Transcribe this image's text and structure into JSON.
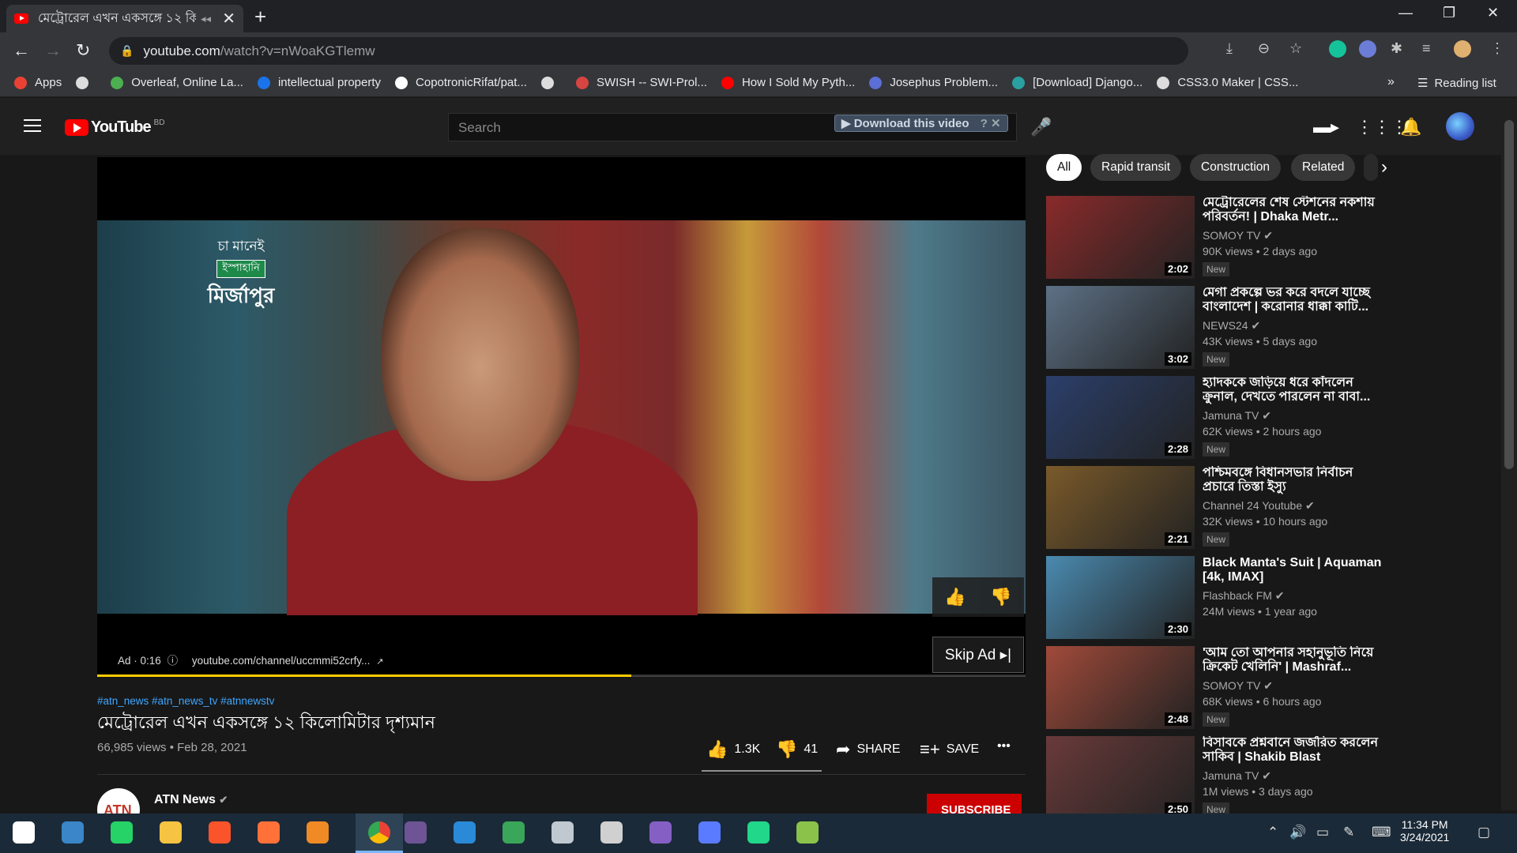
{
  "tab": {
    "title": "মেট্রোরেল এখন একসঙ্গে ১২ কি",
    "mute_symbol": "◂◂",
    "close": "✕",
    "new_tab": "+"
  },
  "window_controls": {
    "minimize": "—",
    "restore": "❐",
    "close": "✕"
  },
  "address": {
    "host": "youtube.com",
    "path": "/watch?v=nWoaKGTlemw"
  },
  "bookmarks": [
    {
      "label": "Apps",
      "color": "#e94235"
    },
    {
      "label": "",
      "color": "#dddddd"
    },
    {
      "label": "Overleaf, Online La...",
      "color": "#4caf50"
    },
    {
      "label": "intellectual property",
      "color": "#1a73e8"
    },
    {
      "label": "CopotronicRifat/pat...",
      "color": "#ffffff"
    },
    {
      "label": "",
      "color": "#dddddd"
    },
    {
      "label": "SWISH -- SWI-Prol...",
      "color": "#d64541"
    },
    {
      "label": "How I Sold My Pyth...",
      "color": "#ff0000"
    },
    {
      "label": "Josephus Problem...",
      "color": "#5b6fd6"
    },
    {
      "label": "[Download] Django...",
      "color": "#2aa0a0"
    },
    {
      "label": "CSS3.0 Maker | CSS...",
      "color": "#dddddd"
    }
  ],
  "bookmarks_overflow": "»",
  "reading_list": "Reading list",
  "masthead": {
    "logo_text": "YouTube",
    "country_code": "BD",
    "search_placeholder": "Search",
    "download_button": "▶ Download this video",
    "download_extras": "? ✕"
  },
  "player": {
    "ad_label": "Ad · 0:16",
    "ad_url": "youtube.com/channel/uccmmi52crfy...",
    "skip_label": "Skip Ad ▸|",
    "progress": 0.575,
    "brand_line1": "চা মানেই",
    "brand_line2": "ইস্পাহানি",
    "brand_line3": "মির্জাপুর"
  },
  "video": {
    "hashtags": "#atn_news #atn_news_tv #atnnewstv",
    "title": "মেট্রোরেল এখন একসঙ্গে ১২ কিলোমিটার দৃশ্যমান",
    "stats": "66,985 views • Feb 28, 2021",
    "likes": "1.3K",
    "dislikes": "41",
    "share": "SHARE",
    "save": "SAVE",
    "more": "•••"
  },
  "channel": {
    "name": "ATN News",
    "avatar_text": "ATN",
    "subscribe": "SUBSCRIBE"
  },
  "chips": [
    "All",
    "Rapid transit",
    "Construction",
    "Related"
  ],
  "chip_next": "›",
  "recommendations": [
    {
      "title": "মেট্রোরেলের শেষ স্টেশনের নকশায় পরিবর্তন! | Dhaka Metr...",
      "channel": "SOMOY TV ✔",
      "meta": "90K views • 2 days ago",
      "duration": "2:02",
      "badge": "New",
      "thumb_color": "#8a2a2a"
    },
    {
      "title": "মেগা প্রকল্পে ভর করে বদলে যাচ্ছে বাংলাদেশ | করোনার ধাক্কা কাটি...",
      "channel": "NEWS24 ✔",
      "meta": "43K views • 5 days ago",
      "duration": "3:02",
      "badge": "New",
      "thumb_color": "#5d7186"
    },
    {
      "title": "হ্যাদককে জড়িয়ে ধরে কাঁদলেন ক্রুনাল, দেখতে পারলেন না বাবা...",
      "channel": "Jamuna TV ✔",
      "meta": "62K views • 2 hours ago",
      "duration": "2:28",
      "badge": "New",
      "thumb_color": "#2b3f6b"
    },
    {
      "title": "পশ্চিমবঙ্গে বিধানসভার নির্বাচন প্রচারে তিস্তা ইস্যু",
      "channel": "Channel 24 Youtube ✔",
      "meta": "32K views • 10 hours ago",
      "duration": "2:21",
      "badge": "New",
      "thumb_color": "#7a5a2a"
    },
    {
      "title": "Black Manta's Suit | Aquaman [4k, IMAX]",
      "channel": "Flashback FM ✔",
      "meta": "24M views • 1 year ago",
      "duration": "2:30",
      "badge": "",
      "thumb_color": "#4a8ab0"
    },
    {
      "title": "'আম তো আপনার সহানুভূতি নিয়ে ক্রিকেট খেলিনি' | Mashraf...",
      "channel": "SOMOY TV ✔",
      "meta": "68K views • 6 hours ago",
      "duration": "2:48",
      "badge": "New",
      "thumb_color": "#a04a3a"
    },
    {
      "title": "বিসাবকে প্রশ্নবানে জর্জরিত করলেন সাকিব | Shakib Blast",
      "channel": "Jamuna TV ✔",
      "meta": "1M views • 3 days ago",
      "duration": "2:50",
      "badge": "New",
      "thumb_color": "#6a3a3a"
    }
  ],
  "taskbar": {
    "apps": [
      {
        "name": "start",
        "color": "#ffffff"
      },
      {
        "name": "search",
        "color": "#3a86c8"
      },
      {
        "name": "whatsapp",
        "color": "#25d366"
      },
      {
        "name": "file-explorer",
        "color": "#f6c343"
      },
      {
        "name": "brave",
        "color": "#fb542b"
      },
      {
        "name": "firefox",
        "color": "#ff7139"
      },
      {
        "name": "app-orange",
        "color": "#f08a24"
      },
      {
        "name": "chrome",
        "color": "#4285f4"
      },
      {
        "name": "github",
        "color": "#6e5494"
      },
      {
        "name": "vscode",
        "color": "#2a8ad8"
      },
      {
        "name": "app-globe",
        "color": "#3aa65a"
      },
      {
        "name": "app-cloud",
        "color": "#c0c8d0"
      },
      {
        "name": "app-satellite",
        "color": "#d0d0d0"
      },
      {
        "name": "visual-studio",
        "color": "#865fc5"
      },
      {
        "name": "messenger",
        "color": "#5a7bff"
      },
      {
        "name": "pycharm",
        "color": "#21d789"
      },
      {
        "name": "app-chart",
        "color": "#8bc34a"
      }
    ],
    "time": "11:34 PM",
    "date": "3/24/2021"
  }
}
